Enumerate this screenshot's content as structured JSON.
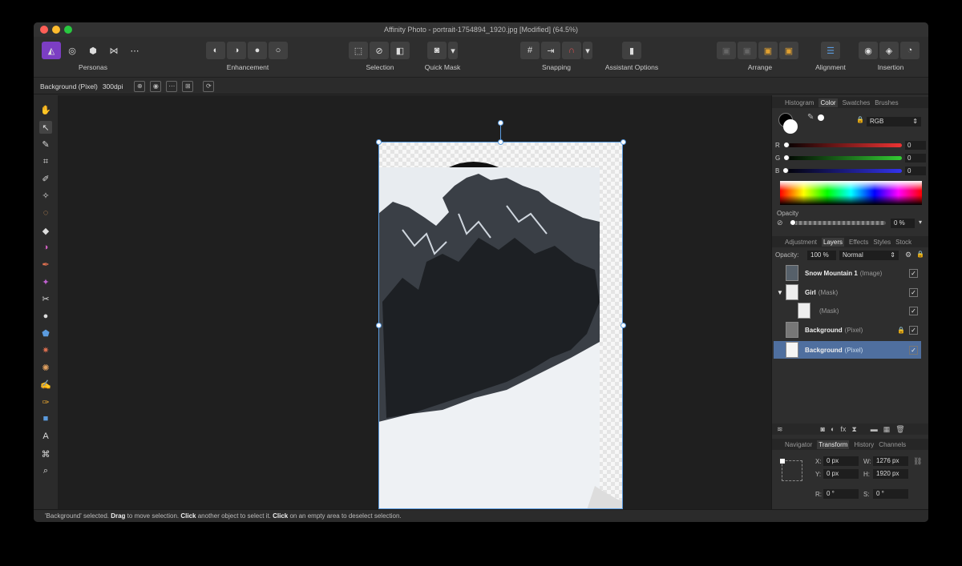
{
  "window": {
    "title": "Affinity Photo - portrait-1754894_1920.jpg [Modified] (64.5%)"
  },
  "toolbar": {
    "personas_label": "Personas",
    "enhancement_label": "Enhancement",
    "selection_label": "Selection",
    "quick_mask_label": "Quick Mask",
    "snapping_label": "Snapping",
    "assistant_label": "Assistant Options",
    "arrange_label": "Arrange",
    "alignment_label": "Alignment",
    "insertion_label": "Insertion"
  },
  "context": {
    "layer_name": "Background (Pixel)",
    "dpi": "300dpi"
  },
  "status": {
    "p1": "'Background' selected. ",
    "b1": "Drag",
    "p2": " to move selection. ",
    "b2": "Click",
    "p3": " another object to select it. ",
    "b3": "Click",
    "p4": " on an empty area to deselect selection."
  },
  "color_panel": {
    "tabs": [
      "Histogram",
      "Color",
      "Swatches",
      "Brushes"
    ],
    "mode": "RGB",
    "r_label": "R",
    "g_label": "G",
    "b_label": "B",
    "r_value": "0",
    "g_value": "0",
    "b_value": "0",
    "opacity_label": "Opacity",
    "opacity_value": "0 %"
  },
  "layers_panel": {
    "tabs": [
      "Adjustment",
      "Layers",
      "Effects",
      "Styles",
      "Stock"
    ],
    "opacity_label": "Opacity:",
    "opacity_value": "100 %",
    "blend_mode": "Normal",
    "layers": [
      {
        "name": "Snow Mountain 1",
        "kind": "(Image)"
      },
      {
        "name": "Girl",
        "kind": "(Mask)"
      },
      {
        "name": "",
        "kind": "(Mask)"
      },
      {
        "name": "Background",
        "kind": "(Pixel)"
      },
      {
        "name": "Background",
        "kind": "(Pixel)"
      }
    ]
  },
  "transform_panel": {
    "tabs": [
      "Navigator",
      "Transform",
      "History",
      "Channels"
    ],
    "x_label": "X:",
    "x_value": "0 px",
    "y_label": "Y:",
    "y_value": "0 px",
    "w_label": "W:",
    "w_value": "1276 px",
    "h_label": "H:",
    "h_value": "1920 px",
    "r_label": "R:",
    "r_value": "0 °",
    "s_label": "S:",
    "s_value": "0 °"
  }
}
